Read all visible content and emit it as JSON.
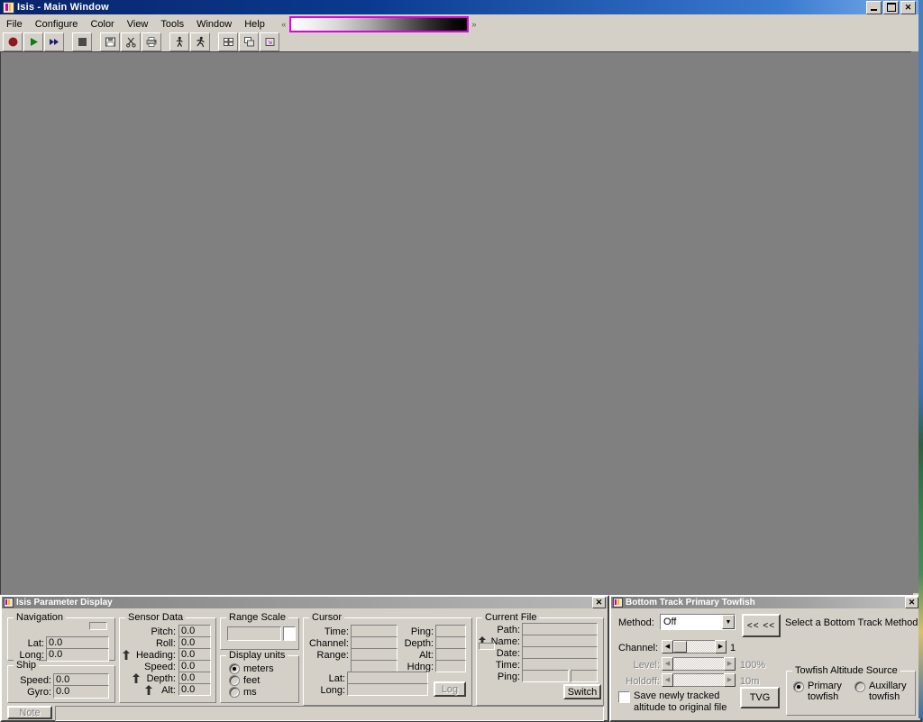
{
  "window": {
    "title": "Isis - Main Window",
    "icon": "isis-app-icon",
    "buttons": {
      "minimize": "_",
      "maximize": "❐",
      "close": "✕"
    }
  },
  "menubar": {
    "items": [
      "File",
      "Configure",
      "Color",
      "View",
      "Tools",
      "Window",
      "Help"
    ],
    "palette": {
      "left_arrow": "«",
      "right_arrow": "»",
      "border_color": "#e000e0"
    }
  },
  "toolbar": {
    "buttons": [
      {
        "name": "record-button",
        "icon": "record-circle-icon",
        "label": "Record"
      },
      {
        "name": "play-button",
        "icon": "play-triangle-icon",
        "label": "Play"
      },
      {
        "name": "fast-forward-button",
        "icon": "fast-forward-icon",
        "label": "Fast Forward"
      },
      {
        "name": "stop-button",
        "icon": "stop-square-icon",
        "label": "Stop"
      },
      {
        "name": "save-button",
        "icon": "floppy-disk-icon",
        "label": "Save"
      },
      {
        "name": "cut-button",
        "icon": "scissors-icon",
        "label": "Cut"
      },
      {
        "name": "print-button",
        "icon": "printer-icon",
        "label": "Print"
      },
      {
        "name": "walk-button",
        "icon": "walking-man-icon",
        "label": "Walk"
      },
      {
        "name": "run-button",
        "icon": "running-man-icon",
        "label": "Run"
      },
      {
        "name": "tile-button",
        "icon": "tile-windows-icon",
        "label": "Tile Windows"
      },
      {
        "name": "cascade-button",
        "icon": "cascade-windows-icon",
        "label": "Cascade Windows"
      },
      {
        "name": "arrange-button",
        "icon": "arrange-icons-icon",
        "label": "Arrange Icons"
      }
    ]
  },
  "workspace": {
    "background": "#808080"
  },
  "parameter_display": {
    "title": "Isis Parameter Display",
    "close": "✕",
    "navigation": {
      "legend": "Navigation",
      "fields": [
        {
          "label": "Lat:",
          "value": "0.0"
        },
        {
          "label": "Long:",
          "value": "0.0"
        }
      ],
      "indicator": "dash-indicator-icon"
    },
    "ship": {
      "legend": "Ship",
      "fields": [
        {
          "label": "Speed:",
          "value": "0.0"
        },
        {
          "label": "Gyro:",
          "value": "0.0"
        }
      ]
    },
    "sensor_data": {
      "legend": "Sensor Data",
      "fields": [
        {
          "icon": "",
          "label": "Pitch:",
          "value": "0.0"
        },
        {
          "icon": "",
          "label": "Roll:",
          "value": "0.0"
        },
        {
          "icon": "up-arrow-icon",
          "label": "Heading:",
          "value": "0.0"
        },
        {
          "icon": "",
          "label": "Speed:",
          "value": "0.0"
        },
        {
          "icon": "up-arrow-icon",
          "label": "Depth:",
          "value": "0.0"
        },
        {
          "icon": "up-arrow-icon",
          "label": "Alt:",
          "value": "0.0"
        }
      ]
    },
    "range_scale": {
      "legend": "Range Scale",
      "value": ""
    },
    "display_units": {
      "legend": "Display units",
      "options": [
        "meters",
        "feet",
        "ms"
      ],
      "selected": "meters"
    },
    "cursor": {
      "legend": "Cursor",
      "left_fields": [
        {
          "label": "Time:",
          "value": ""
        },
        {
          "label": "Channel:",
          "value": ""
        },
        {
          "label": "Range:",
          "value": ""
        },
        {
          "label": "",
          "value": ""
        }
      ],
      "right_fields": [
        {
          "label": "Ping:",
          "value": ""
        },
        {
          "label": "Depth:",
          "value": ""
        },
        {
          "label": "Alt:",
          "value": ""
        },
        {
          "label": "Hdng:",
          "value": ""
        }
      ],
      "lat": {
        "label": "Lat:",
        "value": ""
      },
      "long": {
        "label": "Long:",
        "value": ""
      },
      "log_button": "Log"
    },
    "current_file": {
      "legend": "Current File",
      "fields": [
        {
          "icon": "",
          "label": "Path:",
          "value": ""
        },
        {
          "icon": "up-arrow-icon",
          "label": "Name:",
          "value": ""
        },
        {
          "icon": "dash-indicator-icon",
          "label": "Date:",
          "value": ""
        },
        {
          "icon": "",
          "label": "Time:",
          "value": ""
        },
        {
          "icon": "",
          "label": "Ping:",
          "value": ""
        }
      ],
      "ping_second_value": "",
      "switch_button": "Switch"
    },
    "note_button": "Note",
    "status_text": ""
  },
  "bottom_track": {
    "title": "Bottom Track Primary Towfish",
    "close": "✕",
    "method": {
      "label": "Method:",
      "value": "Off",
      "options": [
        "Off"
      ]
    },
    "prev_button": "<< <<",
    "hint": "Select a Bottom Track Method",
    "channel": {
      "label": "Channel:",
      "value": "1",
      "enabled": true
    },
    "level": {
      "label": "Level:",
      "value": "100%",
      "enabled": false
    },
    "holdoff": {
      "label": "Holdoff:",
      "value": "10m",
      "enabled": false
    },
    "save_checkbox": {
      "line1": "Save newly tracked",
      "line2": "altitude to original file",
      "checked": false
    },
    "tvg_button": "TVG",
    "altitude_source": {
      "legend": "Towfish Altitude Source",
      "options": [
        {
          "line1": "Primary",
          "line2": "towfish"
        },
        {
          "line1": "Auxillary",
          "line2": "towfish"
        }
      ],
      "selected": 0
    }
  }
}
